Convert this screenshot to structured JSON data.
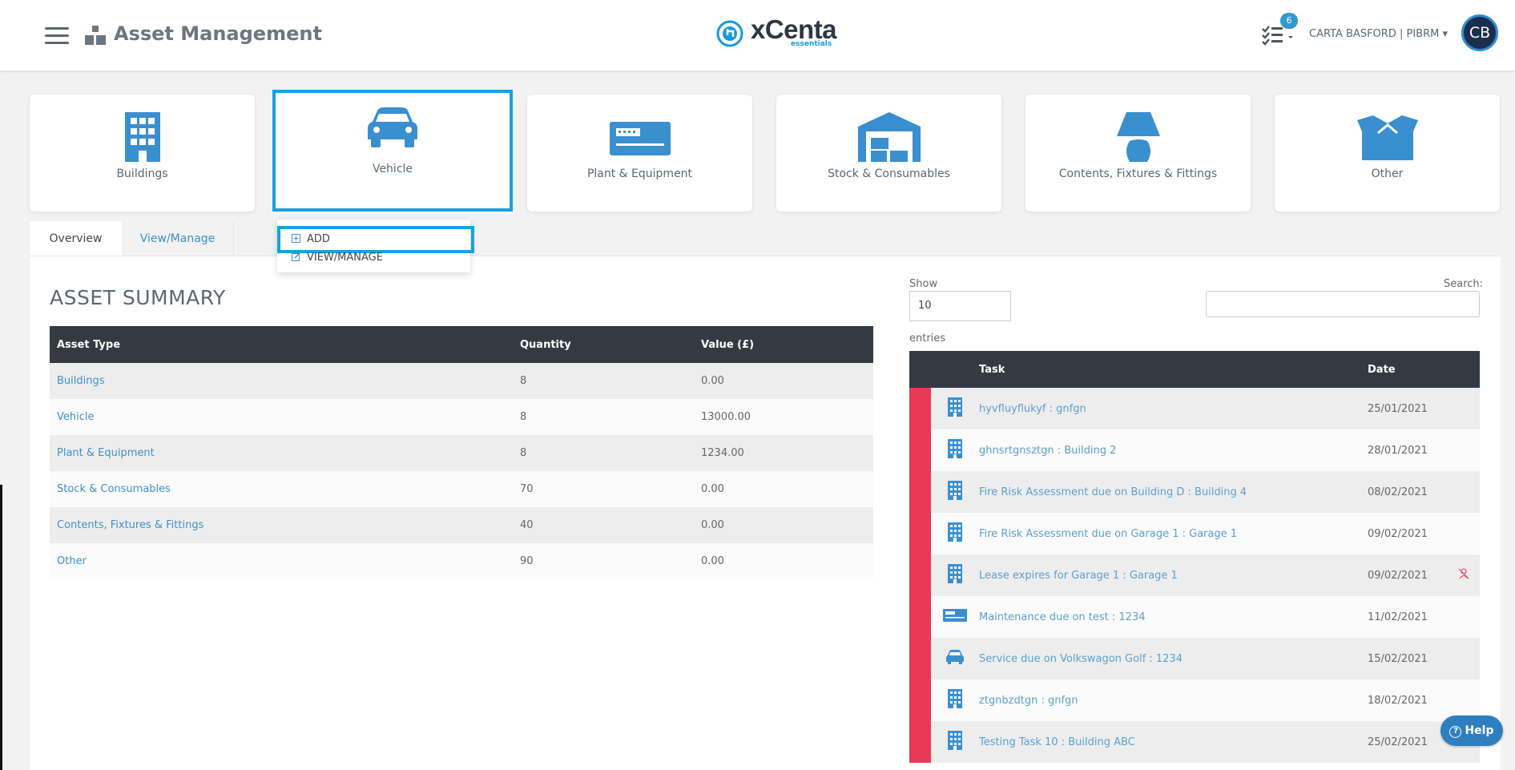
{
  "header": {
    "title": "Asset Management",
    "logo_text": "xCenta",
    "logo_sub": "essentials",
    "task_count": "6",
    "user_label": "CARTA BASFORD | PIBRM ▾",
    "avatar_initials": "CB"
  },
  "categories": [
    {
      "label": "Buildings",
      "icon": "building-icon"
    },
    {
      "label": "Vehicle",
      "icon": "car-icon",
      "selected": true
    },
    {
      "label": "Plant & Equipment",
      "icon": "equipment-icon"
    },
    {
      "label": "Stock & Consumables",
      "icon": "warehouse-icon"
    },
    {
      "label": "Contents, Fixtures & Fittings",
      "icon": "lamp-icon"
    },
    {
      "label": "Other",
      "icon": "box-icon"
    }
  ],
  "tabs": [
    "Overview",
    "View/Manage"
  ],
  "dropdown": {
    "add": "ADD",
    "view": "VIEW/MANAGE"
  },
  "summary": {
    "title": "ASSET SUMMARY",
    "headers": [
      "Asset Type",
      "Quantity",
      "Value (£)"
    ],
    "rows": [
      [
        "Buildings",
        "8",
        "0.00"
      ],
      [
        "Vehicle",
        "8",
        "13000.00"
      ],
      [
        "Plant & Equipment",
        "8",
        "1234.00"
      ],
      [
        "Stock & Consumables",
        "70",
        "0.00"
      ],
      [
        "Contents, Fixtures & Fittings",
        "40",
        "0.00"
      ],
      [
        "Other",
        "90",
        "0.00"
      ]
    ]
  },
  "tasks": {
    "show_label": "Show",
    "show_value": "10",
    "entries_label": "entries",
    "search_label": "Search:",
    "headers": [
      "Task",
      "Date"
    ],
    "rows": [
      {
        "task": "hyvfluyflukyf : gnfgn",
        "date": "25/01/2021",
        "icon": "building-icon"
      },
      {
        "task": "ghnsrtgnsztgn : Building 2",
        "date": "28/01/2021",
        "icon": "building-icon"
      },
      {
        "task": "Fire Risk Assessment due on Building D : Building 4",
        "date": "08/02/2021",
        "icon": "building-icon"
      },
      {
        "task": "Fire Risk Assessment due on Garage 1 : Garage 1",
        "date": "09/02/2021",
        "icon": "building-icon"
      },
      {
        "task": "Lease expires for Garage 1 : Garage 1",
        "date": "09/02/2021",
        "icon": "building-icon",
        "extra": "unassigned-user-icon"
      },
      {
        "task": "Maintenance due on test : 1234",
        "date": "11/02/2021",
        "icon": "equipment-icon"
      },
      {
        "task": "Service due on Volkswagon Golf : 1234",
        "date": "15/02/2021",
        "icon": "car-icon"
      },
      {
        "task": "ztgnbzdtgn : gnfgn",
        "date": "18/02/2021",
        "icon": "building-icon"
      },
      {
        "task": "Testing Task 10 : Building ABC",
        "date": "25/02/2021",
        "icon": "building-icon"
      }
    ]
  },
  "help_label": "Help",
  "colors": {
    "accent": "#1aa0e0",
    "icon_blue": "#3a8fcf",
    "dark": "#333a42",
    "flag_red": "#e63a57"
  }
}
